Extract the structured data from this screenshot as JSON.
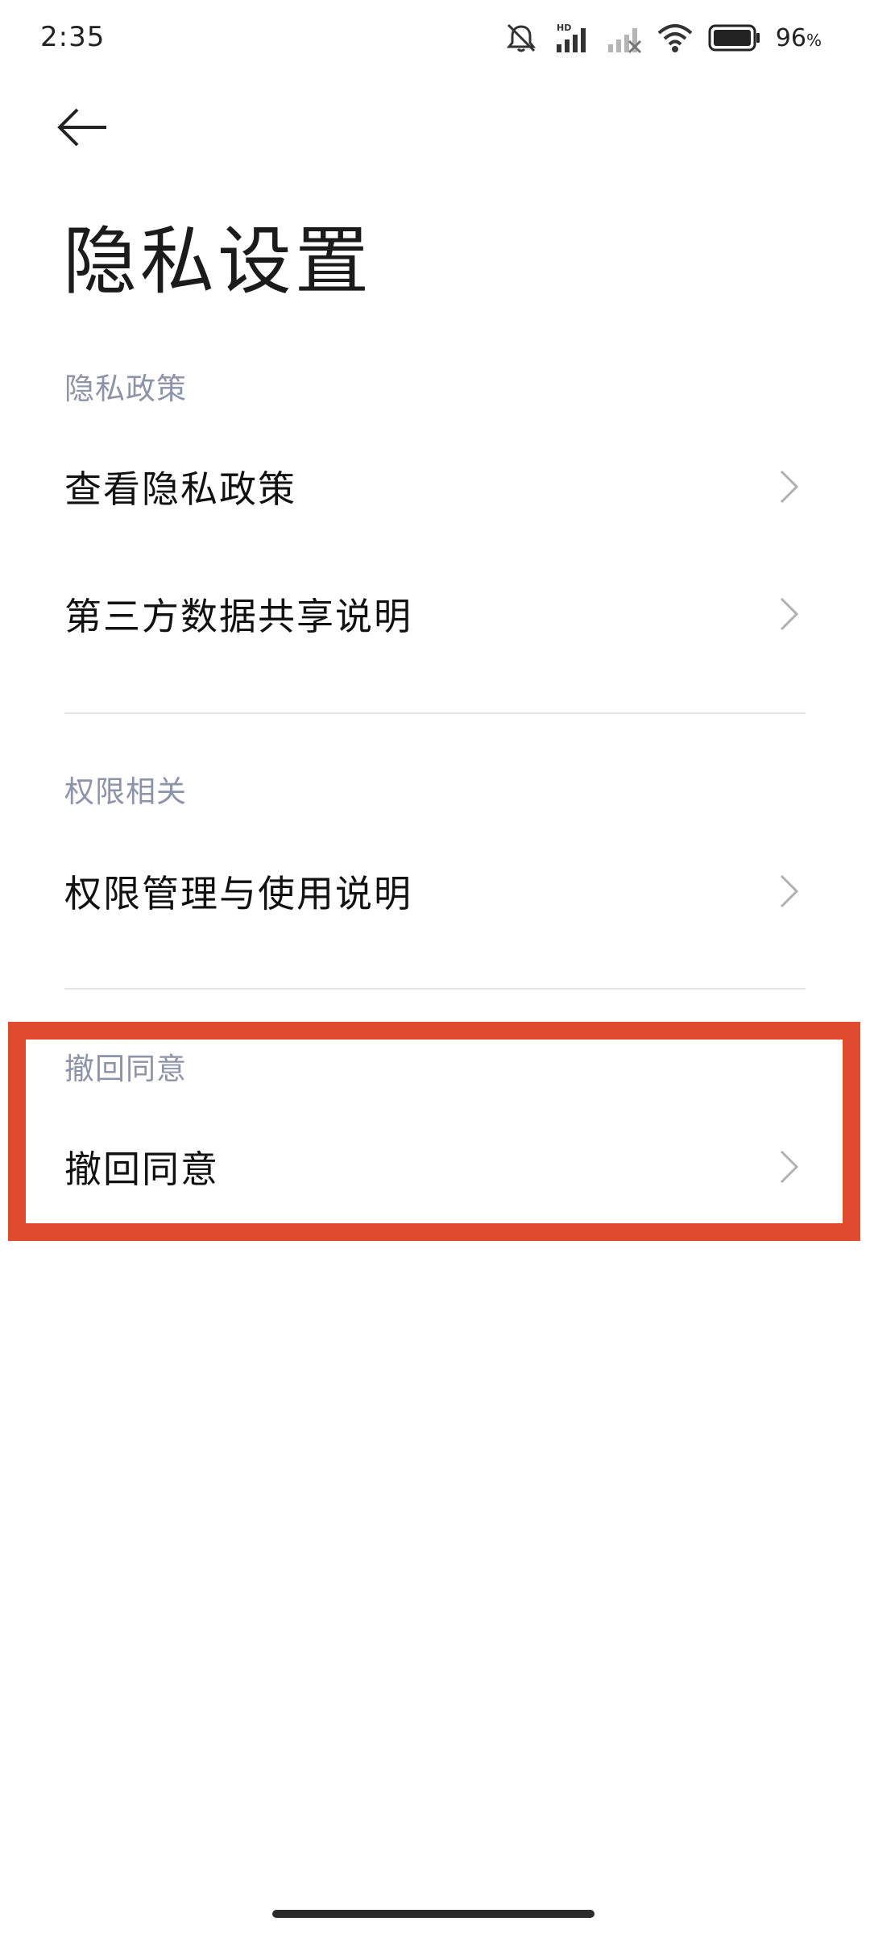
{
  "status_bar": {
    "time": "2:35",
    "battery_percent": "96",
    "battery_unit": "%",
    "icons": [
      "mute-icon",
      "hd-signal-icon",
      "signal-off-icon",
      "wifi-icon",
      "battery-icon"
    ]
  },
  "header": {
    "back_icon": "arrow-left-icon",
    "title": "隐私设置"
  },
  "sections": [
    {
      "header": "隐私政策",
      "items": [
        {
          "label": "查看隐私政策"
        },
        {
          "label": "第三方数据共享说明"
        }
      ]
    },
    {
      "header": "权限相关",
      "items": [
        {
          "label": "权限管理与使用说明"
        }
      ]
    },
    {
      "header": "撤回同意",
      "items": [
        {
          "label": "撤回同意"
        }
      ]
    }
  ],
  "colors": {
    "highlight": "#e04a2e",
    "section_header": "#8d93a8",
    "chevron": "#b0b0b0"
  }
}
